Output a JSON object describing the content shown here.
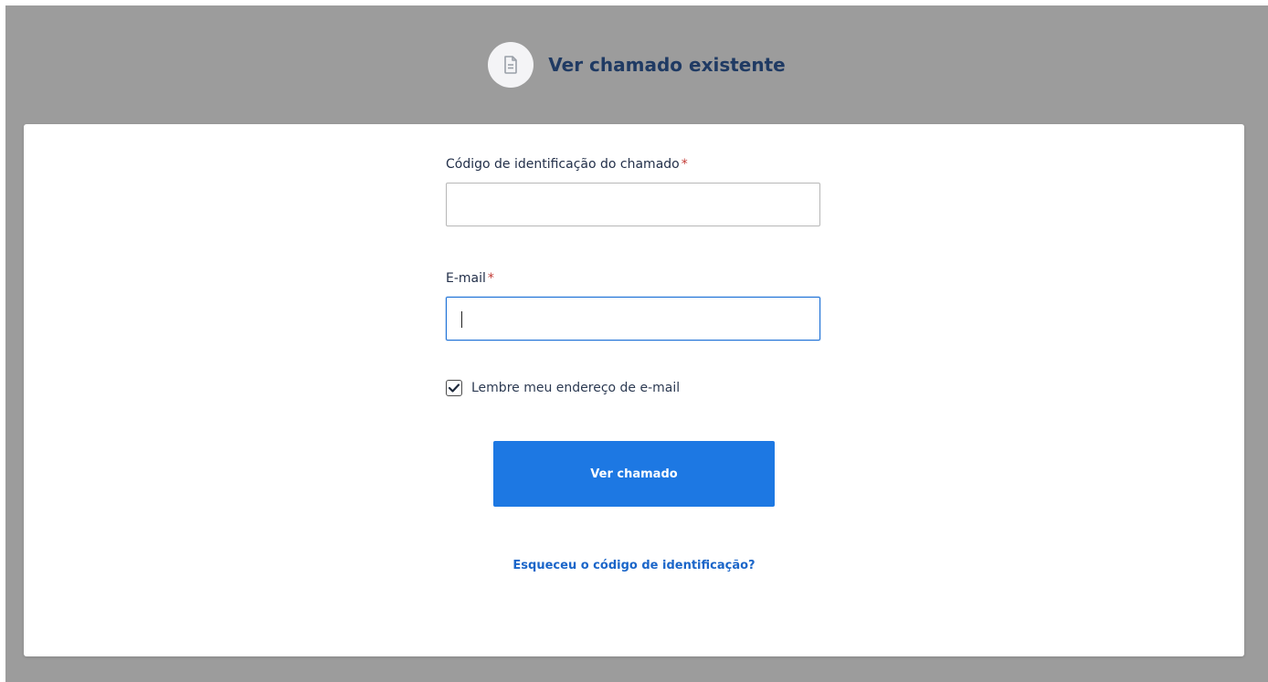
{
  "header": {
    "title": "Ver chamado existente",
    "icon": "document-icon"
  },
  "form": {
    "ticket_id": {
      "label": "Código de identificação do chamado",
      "required_mark": "*",
      "value": "",
      "placeholder": ""
    },
    "email": {
      "label": "E-mail",
      "required_mark": "*",
      "value": "",
      "placeholder": ""
    },
    "remember": {
      "label": "Lembre meu endereço de e-mail",
      "checked": true
    },
    "submit_label": "Ver chamado",
    "forgot_link": "Esqueceu o código de identificação?"
  },
  "colors": {
    "backdrop": "#9c9c9c",
    "title": "#1f3a63",
    "primary": "#1d78e3",
    "link": "#1b66c9",
    "required": "#c23934",
    "focus_border": "#1b6fd6"
  }
}
